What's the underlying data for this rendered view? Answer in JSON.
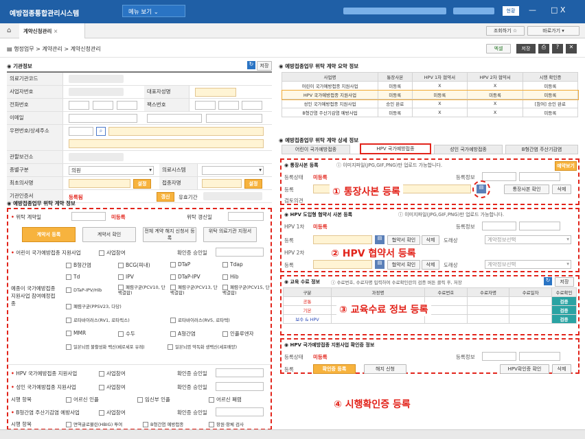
{
  "titlebar": {
    "app_title": "예방접종통합관리시스템",
    "menu_label": "메뉴 보기",
    "help_label": "현황",
    "min_label": "—",
    "close_label": "□ X"
  },
  "tabbar": {
    "home_icon": "home-icon",
    "tab_label": "계약신청관리",
    "tab_close": "×",
    "right_btn1": "조회하기 ☆",
    "right_btn2": "바로가기 ▾"
  },
  "breadcrumb": {
    "text": "행정업무 > 계약관리 > 계약신청관리",
    "btn_excel": "엑셀",
    "btn_save": "저장",
    "btn_q": "?"
  },
  "left": {
    "section1": "기관정보",
    "search_btn": "저장",
    "labels": [
      "의료기관코드",
      "사업자번호",
      "전화번호",
      "이메일",
      "우편번호/상세주소",
      "",
      "관할보건소",
      "종별구분",
      "최초의사명",
      "기관인증서"
    ],
    "corp_label": "대표자성명",
    "fax_label": "팩스번호",
    "type_value": "의원",
    "sys_label": "의료시스템",
    "apply_btn1": "설정",
    "apply_btn2": "설정",
    "doc_label": "접종자명",
    "cert_value": "등록됨",
    "cert_btn": "갱신",
    "period_label": "유효기간",
    "section2": "예방접종업무 위탁 계약 정보",
    "contract_date_label": "위탁 계약일",
    "contract_status": "미등록",
    "renew_label": "위탁 갱신일",
    "btn_reg": "계약서 등록",
    "btn_view": "계약서 확인",
    "btn_cancel": "전체 계약 해지 신청서 등록",
    "btn_other": "위탁 의료기관 지정서",
    "child_label": "어린이 국가예방접종 지원사업",
    "part_label": "사업참여",
    "confirm_label": "확인증 승인일",
    "vaccine_group_label": "예종이 국가예방접종 지원사업 참여예정접종",
    "vaccines": [
      "B형간염",
      "BCG(피내)",
      "DTaP",
      "Tdap",
      "Td",
      "IPV",
      "DTaP-IPV",
      "Hib",
      "DTaP-IPV/Hib",
      "폐렴구균(PCV10, 단백결합)",
      "폐렴구균(PCV13, 단백결합)",
      "폐렴구균(PCV15, 단백결합)",
      "폐렴구균(PPSV23, 다당)",
      "로타바이러스(RV1, 로타릭스)",
      "로타바이러스(RV5, 로타텍)",
      "MMR",
      "수두",
      "A형간염",
      "인플루엔자",
      "일본뇌염 불활성화 백신(베로세포 유래)",
      "일본뇌염 약독화 생백신(세포배양)"
    ],
    "hpv_label": "HPV 국가예방접종 지원사업",
    "adult_label": "성인 국가예방접종 지원사업",
    "proj_label": "시행 항목",
    "proj_opts": [
      "어르신 인플",
      "임신부 인플",
      "어르신 폐렴"
    ],
    "hepb_label": "B형간염 주산기감염 예방사업",
    "hepb_proj": "시행 항목",
    "hepb_opts": [
      "면역글로불린(HBIG) 투여",
      "B형간염 예방접종",
      "항원·항체 검사"
    ]
  },
  "right": {
    "summary_title": "예방접종업무 위탁 계약 요약 정보",
    "summary_headers": [
      "사업명",
      "통장사본",
      "HPV 1차 협약서",
      "HPV 2차 협약서",
      "시행 확인증"
    ],
    "summary_rows": [
      [
        "어린이 국가예방접종 지원사업",
        "미등록",
        "X",
        "X",
        "미등록"
      ],
      [
        "HPV 국가예방접종 지원사업",
        "미등록",
        "미등록",
        "미등록",
        "미등록"
      ],
      [
        "성인 국가예방접종 지원사업",
        "승인 완료",
        "X",
        "X",
        "[참여] 승인 완료"
      ],
      [
        "B형간염 주산기감염 예방사업",
        "미등록",
        "X",
        "X",
        "미등록"
      ]
    ],
    "detail_title": "예방접종업무 위탁 계약 상세 정보",
    "detail_tabs": [
      "어린이 국가예방접종",
      "HPV 국가예방접종",
      "성인 국가예방접종",
      "B형간염 주산기감염"
    ],
    "bank_title": "통장사본 등록",
    "bank_note": "이미지파일(JPG,GIF,PNG)만 업로드 가능합니다.",
    "bank_btn": "예약보기",
    "bank_status_label": "등록상태",
    "bank_status": "미등록",
    "bank_info_label": "등록정보",
    "bank_reg_label": "등록",
    "bank_view_btn": "통장사본 확인",
    "bank_del_btn": "삭제",
    "bank_review_label": "검토의견",
    "bank_overlay": "① 통장사본 등록",
    "hpv_title": "HPV 도입형 협약서 사본 등록",
    "hpv_note": "이미지파일(JPG,GIF,PNG)만 업로드 가능합니다.",
    "hpv1_label": "HPV 1차",
    "hpv1_status": "미등록",
    "hpv_info_label": "등록정보",
    "hpv_reg_label": "등록",
    "hpv_view_btn": "협약서 확인",
    "hpv_del_btn": "삭제",
    "hpv_status_label": "도래상",
    "hpv_select": "계약정보선택",
    "hpv2_label": "HPV 2차",
    "hpv_overlay": "② HPV 협약서 등록",
    "edu_title": "교육 수료 정보",
    "edu_note": "수료번호, 수료자명 입력하여 수료확인란의 검증 버튼 클릭 후, 저장",
    "edu_save": "저장",
    "edu_headers": [
      "구분",
      "과정명",
      "수료번호",
      "수료자명",
      "수료일자",
      "수료확인"
    ],
    "edu_rows": [
      [
        "공통",
        "",
        "",
        "",
        "",
        "검증"
      ],
      [
        "기본",
        "",
        "",
        "",
        "",
        "검증"
      ],
      [
        "보수 & HPV",
        "",
        "",
        "",
        "",
        "검증"
      ]
    ],
    "edu_overlay": "③ 교육수료 정보 등록",
    "cert_title": "HPV 국가예방접종 지원사업 확인증 정보",
    "cert_status_label": "등록상태",
    "cert_status": "미등록",
    "cert_info_label": "등록정보",
    "cert_reg_label": "등록",
    "cert_reg_btn": "확인증 등록",
    "cert_cancel_btn": "해지 신청",
    "cert_view_btn": "HPV확인증 확인",
    "cert_del_btn": "삭제",
    "cert_overlay": "④ 시행확인증 등록"
  }
}
